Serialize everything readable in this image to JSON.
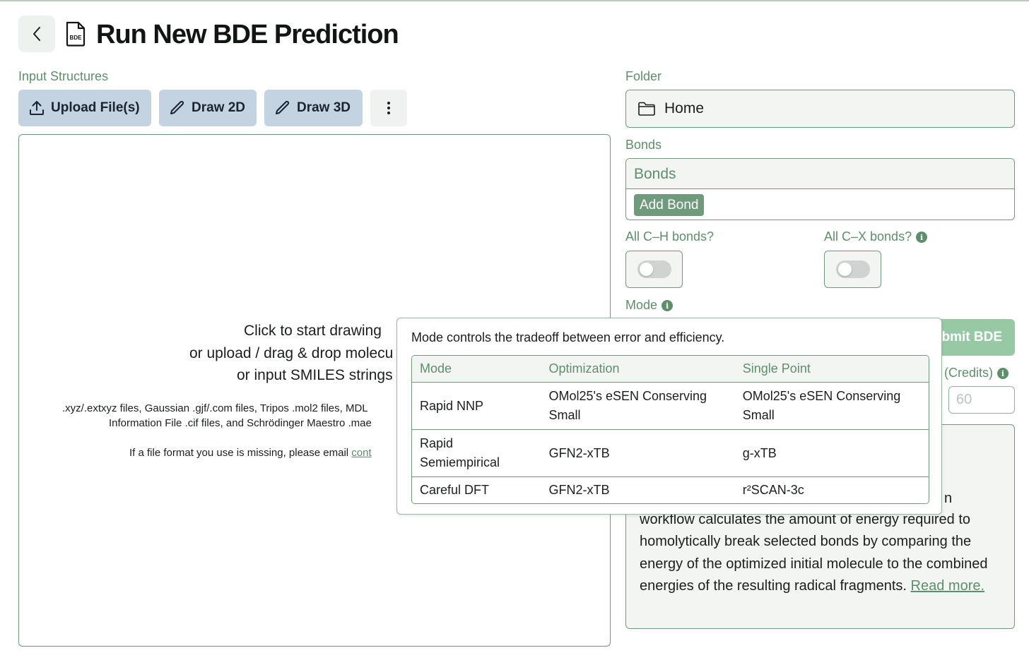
{
  "header": {
    "title": "Run New BDE Prediction",
    "doc_icon_text": "BDE"
  },
  "input": {
    "section_label": "Input Structures",
    "buttons": {
      "upload": "Upload File(s)",
      "draw2d": "Draw 2D",
      "draw3d": "Draw 3D"
    },
    "drop_zone": {
      "line1": "Click to start drawing",
      "line2": "or upload / drag & drop molecu",
      "line3": "or input SMILES strings",
      "formats1": ".xyz/.extxyz files, Gaussian .gjf/.com files, Tripos .mol2 files, MDL",
      "formats2": "Information File .cif files, and Schrödinger Maestro .mae",
      "missing_text": "If a file format you use is missing, please email ",
      "missing_link": "cont"
    }
  },
  "settings": {
    "folder_label": "Folder",
    "folder_value": "Home",
    "bonds_label": "Bonds",
    "bonds_header": "Bonds",
    "add_bond": "Add Bond",
    "all_ch_label": "All C–H bonds?",
    "all_cx_label": "All C–X bonds?",
    "all_ch_on": false,
    "all_cx_on": false,
    "mode_label": "Mode",
    "submit_label": "bmit BDE",
    "credits_label": "(Credits)",
    "credits_value": "60"
  },
  "description": {
    "fragment": "n",
    "text": "workflow calculates the amount of energy required to homolytically break selected bonds by comparing the energy of the optimized initial molecule to the combined energies of the resulting radical fragments.",
    "read_more": "Read more."
  },
  "mode_popover": {
    "title": "Mode controls the tradeoff between error and efficiency.",
    "columns": [
      "Mode",
      "Optimization",
      "Single Point"
    ],
    "rows": [
      {
        "mode": "Rapid NNP",
        "optimization": "OMol25's eSEN Conserving Small",
        "single_point": "OMol25's eSEN Conserving Small"
      },
      {
        "mode": "Rapid Semiempirical",
        "optimization": "GFN2-xTB",
        "single_point": "g-xTB"
      },
      {
        "mode": "Careful DFT",
        "optimization": "GFN2-xTB",
        "single_point": "r²SCAN-3c"
      }
    ]
  },
  "colors": {
    "accent": "#5e8f6b",
    "border": "#6f9a7b",
    "tool_button": "#c3d3e1",
    "submit": "#98c9a5"
  }
}
